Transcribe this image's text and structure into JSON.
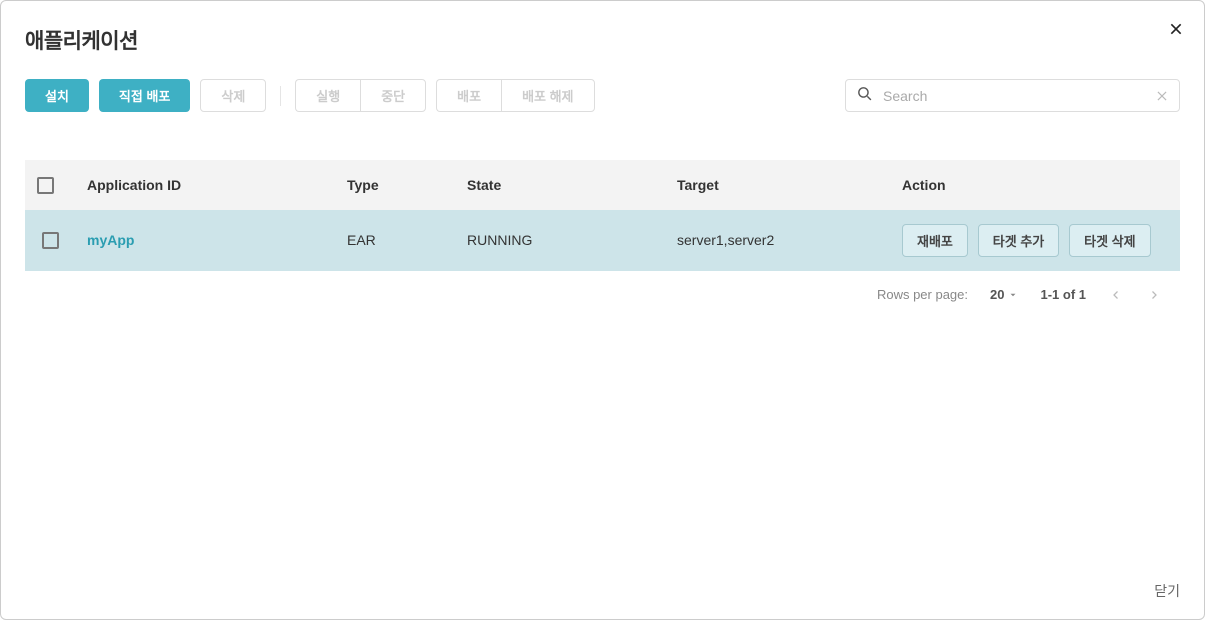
{
  "dialog": {
    "title": "애플리케이션",
    "close_label": "닫기"
  },
  "toolbar": {
    "install_label": "설치",
    "direct_deploy_label": "직접 배포",
    "delete_label": "삭제",
    "run_label": "실행",
    "stop_label": "중단",
    "deploy_label": "배포",
    "undeploy_label": "배포 해제"
  },
  "search": {
    "placeholder": "Search",
    "value": ""
  },
  "table": {
    "headers": {
      "app_id": "Application ID",
      "type": "Type",
      "state": "State",
      "target": "Target",
      "action": "Action"
    },
    "rows": [
      {
        "app_id": "myApp",
        "type": "EAR",
        "state": "RUNNING",
        "target": "server1,server2",
        "actions": {
          "redeploy": "재배포",
          "add_target": "타겟 추가",
          "delete_target": "타겟 삭제"
        }
      }
    ]
  },
  "pagination": {
    "rows_per_page_label": "Rows per page:",
    "page_size": "20",
    "range": "1-1 of 1"
  }
}
